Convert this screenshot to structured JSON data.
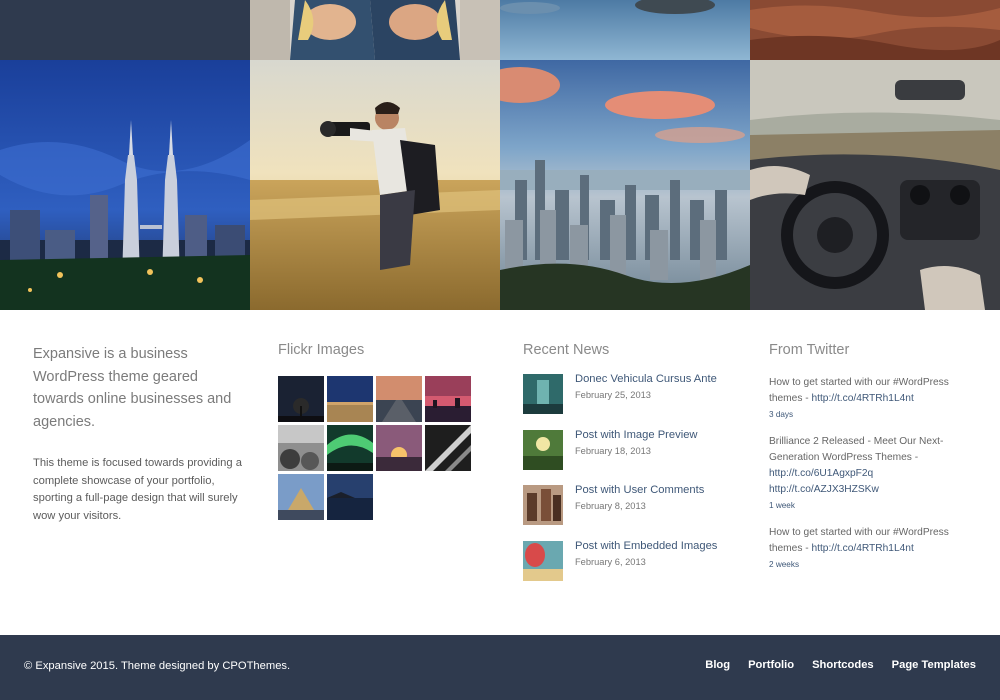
{
  "intro": {
    "lead": "Expansive is a business WordPress theme geared towards online businesses and agencies.",
    "body": "This theme is focused towards providing a complete showcase of your portfolio, sporting a full-page design that will surely wow your visitors."
  },
  "flickr": {
    "title": "Flickr Images"
  },
  "news": {
    "title": "Recent News",
    "items": [
      {
        "title": "Donec Vehicula Cursus Ante",
        "date": "February 25, 2013"
      },
      {
        "title": "Post with Image Preview",
        "date": "February 18, 2013"
      },
      {
        "title": "Post with User Comments",
        "date": "February 8, 2013"
      },
      {
        "title": "Post with Embedded Images",
        "date": "February 6, 2013"
      }
    ]
  },
  "twitter": {
    "title": "From Twitter",
    "tweets": [
      {
        "text": "How to get started with our #WordPress themes - ",
        "links": [
          "http://t.co/4RTRh1L4nt"
        ],
        "time": "3 days"
      },
      {
        "text": "Brilliance 2 Released - Meet Our Next-Generation WordPress Themes - ",
        "links": [
          "http://t.co/6U1AgxpF2q",
          "http://t.co/AZJX3HZSKw"
        ],
        "time": "1 week"
      },
      {
        "text": "How to get started with our #WordPress themes - ",
        "links": [
          "http://t.co/4RTRh1L4nt"
        ],
        "time": "2 weeks"
      }
    ]
  },
  "footer": {
    "copyright": "© Expansive 2015. Theme designed by CPOThemes.",
    "nav": [
      "Blog",
      "Portfolio",
      "Shortcodes",
      "Page Templates"
    ]
  },
  "colors": {
    "footer_bg": "#2f3a4e",
    "link": "#3f5878",
    "heading": "#8a8a8a"
  }
}
